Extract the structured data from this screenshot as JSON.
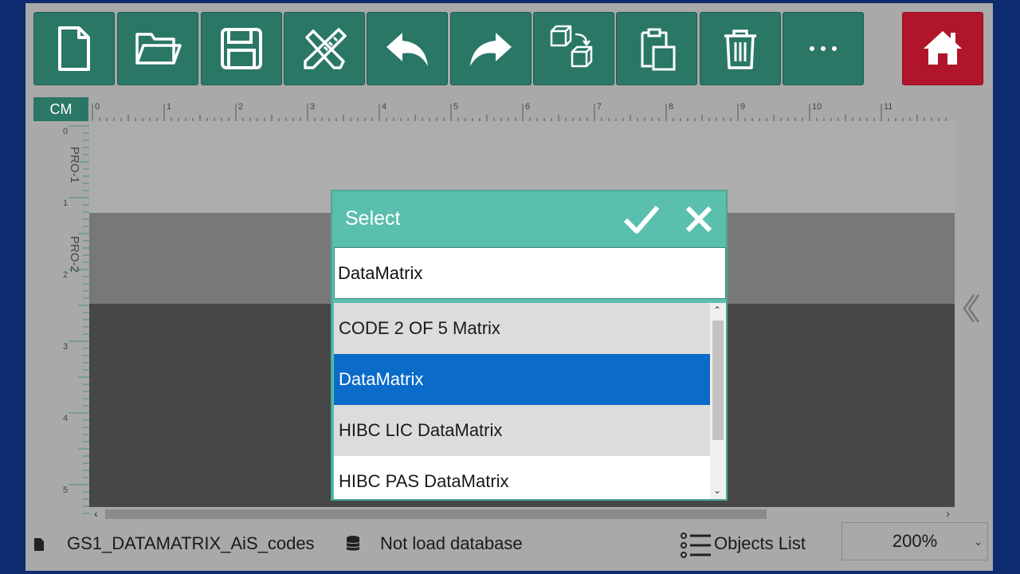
{
  "toolbar": {
    "buttons": [
      {
        "name": "new-file",
        "icon": "new-file-icon"
      },
      {
        "name": "open-folder",
        "icon": "folder-open-icon"
      },
      {
        "name": "save",
        "icon": "floppy-disk-icon"
      },
      {
        "name": "design-tools",
        "icon": "ruler-pencil-icon"
      },
      {
        "name": "undo",
        "icon": "undo-icon"
      },
      {
        "name": "redo",
        "icon": "redo-icon"
      },
      {
        "name": "copy-objects",
        "icon": "copy-cubes-icon"
      },
      {
        "name": "paste",
        "icon": "clipboard-icon"
      },
      {
        "name": "delete",
        "icon": "trash-icon"
      },
      {
        "name": "more",
        "icon": "ellipsis-icon"
      }
    ],
    "home_icon": "home-icon",
    "color": "#2a7766",
    "home_color": "#b1152b"
  },
  "ruler": {
    "unit": "CM",
    "h_labels": [
      "0",
      "1",
      "2",
      "3",
      "4",
      "5",
      "6",
      "7",
      "8",
      "9",
      "10",
      "11",
      "1"
    ],
    "v_labels": [
      "0",
      "1",
      "2",
      "3",
      "4",
      "5"
    ],
    "lanes": [
      "PRO-1",
      "PRO-2"
    ]
  },
  "dialog": {
    "title": "Select",
    "confirm_icon": "checkmark-icon",
    "cancel_icon": "close-icon",
    "search_value": "DataMatrix",
    "items": [
      {
        "label": "CODE 2 OF 5 Matrix",
        "selected": false
      },
      {
        "label": "DataMatrix",
        "selected": true
      },
      {
        "label": "HIBC LIC DataMatrix",
        "selected": false
      },
      {
        "label": "HIBC PAS DataMatrix",
        "selected": false
      }
    ],
    "header_color": "#5bbfad",
    "selected_color": "#0b6bc9"
  },
  "status": {
    "file_icon": "file-icon",
    "file_name": "GS1_DATAMATRIX_AiS_codes",
    "db_icon": "database-icon",
    "db_text": "Not load database",
    "list_icon": "list-icon",
    "objects_list_label": "Objects List",
    "zoom": "200%"
  }
}
